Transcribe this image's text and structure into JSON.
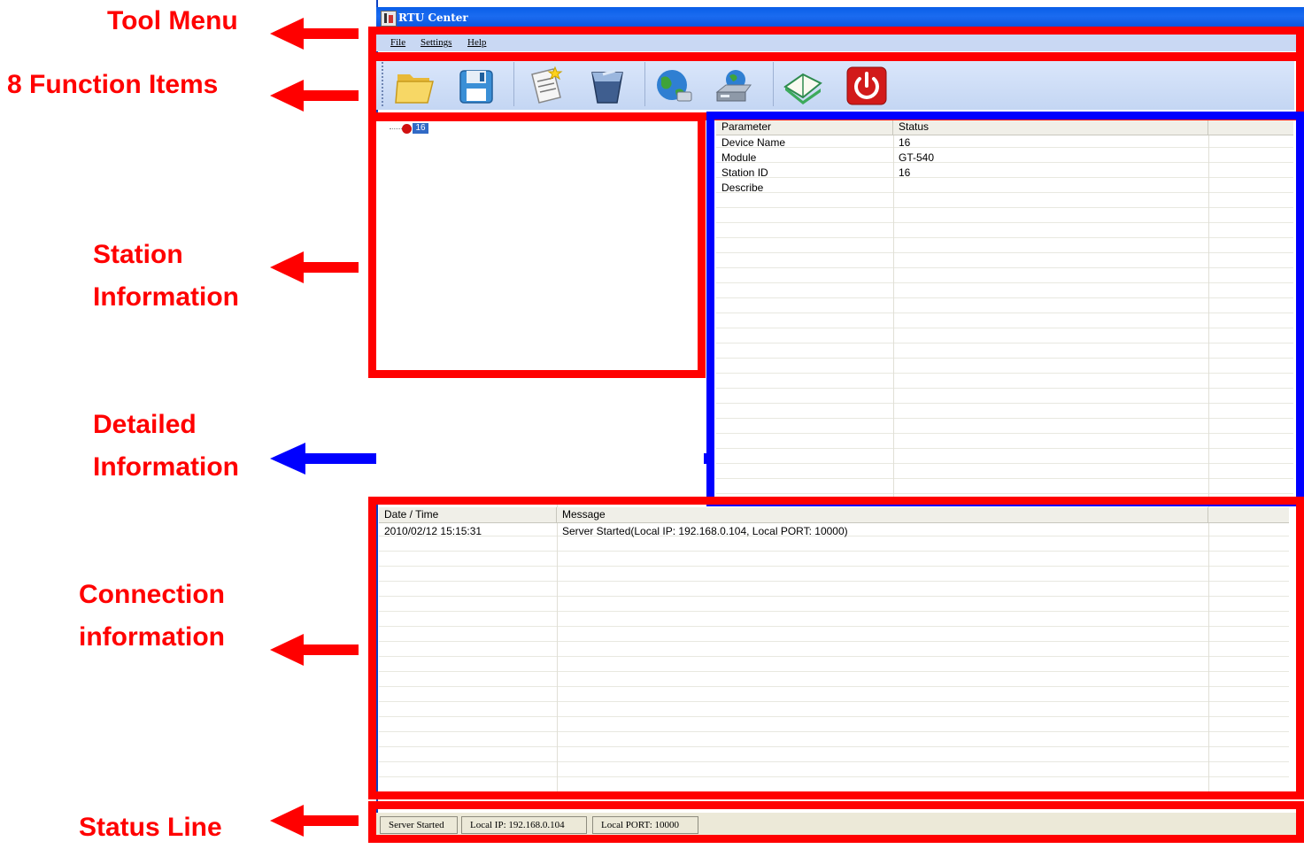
{
  "annotations": {
    "tool_menu": "Tool Menu",
    "function_items": "8 Function Items",
    "station_info_line1": "Station",
    "station_info_line2": "Information",
    "detailed_info_line1": "Detailed",
    "detailed_info_line2": "Information",
    "connection_info_line1": "Connection",
    "connection_info_line2": "information",
    "status_line": "Status Line",
    "colors": {
      "red": "#ff0000",
      "blue": "#0000ff"
    }
  },
  "window": {
    "title": "RTU Center",
    "icon": "rtu-app-icon"
  },
  "menu": {
    "items": [
      "File",
      "Settings",
      "Help"
    ]
  },
  "toolbar": {
    "buttons": [
      {
        "name": "open-folder-icon"
      },
      {
        "name": "save-disk-icon"
      },
      {
        "name": "new-document-icon"
      },
      {
        "name": "recycle-bin-icon"
      },
      {
        "name": "globe-connect-icon"
      },
      {
        "name": "network-server-icon"
      },
      {
        "name": "open-book-icon"
      },
      {
        "name": "power-exit-icon"
      }
    ]
  },
  "station_tree": {
    "node_label": "16",
    "node_status_color": "#d01010"
  },
  "details": {
    "headers": [
      "Parameter",
      "Status"
    ],
    "rows": [
      {
        "param": "Device Name",
        "status": "16"
      },
      {
        "param": "Module",
        "status": "GT-540"
      },
      {
        "param": "Station ID",
        "status": "16"
      },
      {
        "param": "Describe",
        "status": ""
      }
    ]
  },
  "log": {
    "headers": [
      "Date / Time",
      "Message"
    ],
    "rows": [
      {
        "datetime": "2010/02/12   15:15:31",
        "message": "Server Started(Local IP: 192.168.0.104, Local PORT: 10000)"
      }
    ]
  },
  "status": {
    "state": "Server Started",
    "ip": "Local IP: 192.168.0.104",
    "port": "Local PORT: 10000"
  }
}
